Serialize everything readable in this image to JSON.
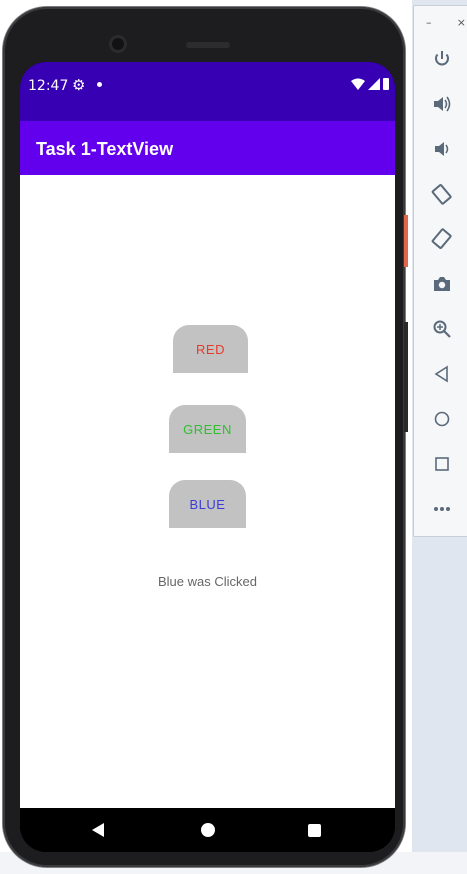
{
  "status_bar": {
    "time": "12:47"
  },
  "app_bar": {
    "title": "Task 1-TextView"
  },
  "buttons": {
    "red": "RED",
    "green": "GREEN",
    "blue": "BLUE"
  },
  "message": "Blue was Clicked",
  "colors": {
    "status_bar": "#3700b3",
    "app_bar": "#6200ee",
    "red_text": "#e53b2c",
    "green_text": "#2fbf2f",
    "blue_text": "#3b3bd9"
  },
  "emulator_toolbar": {
    "window_controls": [
      "–",
      "×"
    ],
    "items": [
      {
        "icon": "power-icon"
      },
      {
        "icon": "volume-up-icon"
      },
      {
        "icon": "volume-down-icon"
      },
      {
        "icon": "rotate-left-icon"
      },
      {
        "icon": "rotate-right-icon"
      },
      {
        "icon": "camera-icon"
      },
      {
        "icon": "zoom-icon"
      },
      {
        "icon": "back-icon"
      },
      {
        "icon": "home-icon"
      },
      {
        "icon": "overview-icon"
      },
      {
        "icon": "more-icon"
      }
    ]
  }
}
